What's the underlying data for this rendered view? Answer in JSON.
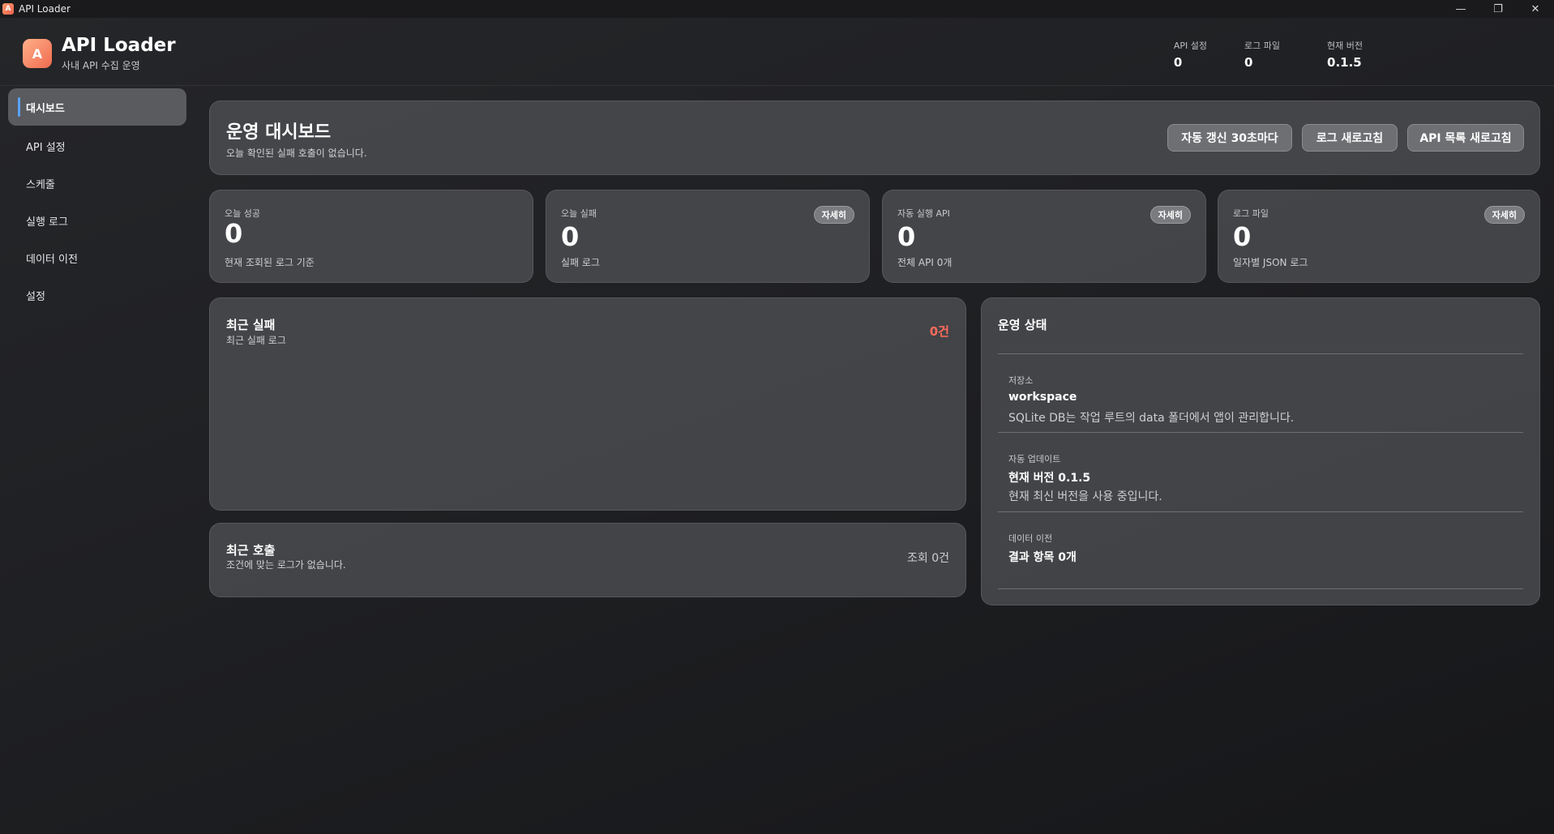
{
  "window": {
    "title": "API Loader",
    "icon_letter": "A",
    "minimize": "—",
    "maximize": "❐",
    "close": "✕"
  },
  "header": {
    "logo_letter": "A",
    "app_name": "API Loader",
    "subtitle": "사내 API 수집 운영",
    "stats": [
      {
        "label": "API 설정",
        "value": "0"
      },
      {
        "label": "로그 파일",
        "value": "0"
      },
      {
        "label": "현재 버전",
        "value": "0.1.5"
      }
    ]
  },
  "sidebar": {
    "items": [
      {
        "label": "대시보드",
        "active": true
      },
      {
        "label": "API 설정"
      },
      {
        "label": "스케줄"
      },
      {
        "label": "실행 로그"
      },
      {
        "label": "데이터 이전"
      },
      {
        "label": "설정"
      }
    ]
  },
  "hero": {
    "title": "운영 대시보드",
    "subtitle": "오늘 확인된 실패 호출이 없습니다.",
    "buttons": [
      "자동 갱신 30초마다",
      "로그 새로고침",
      "API 목록 새로고침"
    ]
  },
  "kpis": [
    {
      "label": "오늘 성공",
      "value": "0",
      "sub": "현재 조회된 로그 기준"
    },
    {
      "label": "오늘 실패",
      "value": "0",
      "sub": "실패 로그",
      "badge": "자세히"
    },
    {
      "label": "자동 실행 API",
      "value": "0",
      "sub": "전체 API 0개",
      "badge": "자세히"
    },
    {
      "label": "로그 파일",
      "value": "0",
      "sub": "일자별 JSON 로그",
      "badge": "자세히"
    }
  ],
  "recent_failures": {
    "title": "최근 실패",
    "subtitle": "최근 실패 로그",
    "count": "0건"
  },
  "recent_calls": {
    "title": "최근 호출",
    "subtitle": "조건에 맞는 로그가 없습니다.",
    "count": "조회 0건"
  },
  "status": {
    "title": "운영 상태",
    "items": [
      {
        "label": "저장소",
        "value": "workspace",
        "desc": "SQLite DB는 작업 루트의 data 폴더에서 앱이 관리합니다."
      },
      {
        "label": "자동 업데이트",
        "value": "현재 버전 0.1.5",
        "desc": "현재 최신 버전을 사용 중입니다."
      },
      {
        "label": "데이터 이전",
        "value": "결과 항목 0개",
        "desc": ""
      }
    ]
  },
  "colors": {
    "accent": "#5aa2ff",
    "brand": "#f06a4e",
    "failure": "#ff6b5a"
  }
}
